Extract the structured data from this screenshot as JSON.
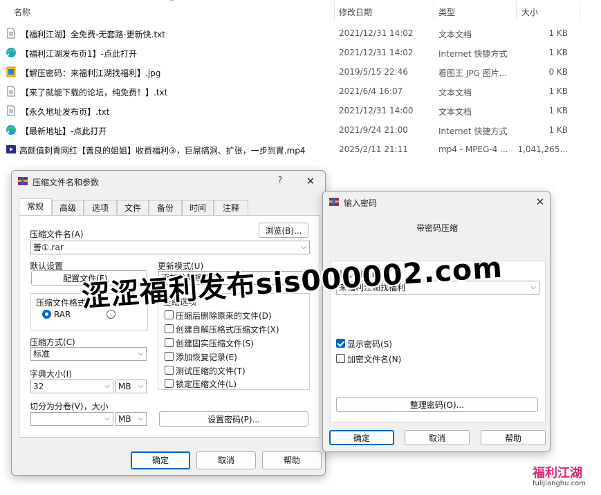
{
  "explorer": {
    "columns": {
      "name": "名称",
      "modified": "修改日期",
      "type": "类型",
      "size": "大小"
    },
    "files": [
      {
        "icon": "text-file-icon",
        "name": "【福利江湖】全免费-无套路-更新快.txt",
        "date": "2021/12/31 14:02",
        "type": "文本文档",
        "size": "1 KB"
      },
      {
        "icon": "internet-shortcut-icon",
        "name": "【福利江湖发布页1】-点此打开",
        "date": "2021/12/31 14:02",
        "type": "Internet 快捷方式",
        "size": "1 KB"
      },
      {
        "icon": "image-file-icon",
        "name": "【解压密码：来福利江湖找福利】.jpg",
        "date": "2019/5/15 22:46",
        "type": "看图王 JPG 图片...",
        "size": "0 KB"
      },
      {
        "icon": "text-file-icon",
        "name": "【来了就能下载的论坛，纯免费！】.txt",
        "date": "2021/6/4 16:07",
        "type": "文本文档",
        "size": "1 KB"
      },
      {
        "icon": "text-file-icon",
        "name": "【永久地址发布页】.txt",
        "date": "2021/12/31 14:00",
        "type": "文本文档",
        "size": "1 KB"
      },
      {
        "icon": "internet-shortcut-icon",
        "name": "【最新地址】-点此打开",
        "date": "2021/9/24 21:00",
        "type": "Internet 快捷方式",
        "size": "1 KB"
      },
      {
        "icon": "video-file-icon",
        "name": "高颜值刺青网红【善良的姐姐】收费福利③，巨屌搞洞、扩张，一步到胃.mp4",
        "date": "2025/2/11 21:11",
        "type": "mp4 - MPEG-4 ...",
        "size": "1,041,265..."
      }
    ]
  },
  "archive_dialog": {
    "title": "压缩文件名和参数",
    "help": "?",
    "tabs": [
      "常规",
      "高级",
      "选项",
      "文件",
      "备份",
      "时间",
      "注释"
    ],
    "archive_name_label": "压缩文件名(A)",
    "browse_button": "浏览(B)...",
    "archive_name_value": "善①.rar",
    "default_settings_label": "默认设置",
    "profiles_button": "配置文件(F)...",
    "update_mode_label": "更新模式(U)",
    "update_mode_value": "添加并替换文件",
    "format_label": "压缩文件格式",
    "format_rar": "RAR",
    "options_label": "压缩选项",
    "options": [
      {
        "label": "压缩后删除原来的文件(D)",
        "checked": false
      },
      {
        "label": "创建自解压格式压缩文件(X)",
        "checked": false
      },
      {
        "label": "创建固实压缩文件(S)",
        "checked": false
      },
      {
        "label": "添加恢复记录(E)",
        "checked": false
      },
      {
        "label": "测试压缩的文件(T)",
        "checked": false
      },
      {
        "label": "锁定压缩文件(L)",
        "checked": false
      }
    ],
    "method_label": "压缩方式(C)",
    "method_value": "标准",
    "dict_label": "字典大小(I)",
    "dict_value": "32",
    "dict_unit": "MB",
    "split_label": "切分为分卷(V)，大小",
    "split_value": "",
    "split_unit": "MB",
    "set_password_button": "设置密码(P)...",
    "ok": "确定",
    "cancel": "取消",
    "help_button": "帮助"
  },
  "password_dialog": {
    "title": "输入密码",
    "heading": "带密码压缩",
    "password_label": "输入密码(E)",
    "password_value": "来福利江湖找福利",
    "show_password": {
      "label": "显示密码(S)",
      "checked": true
    },
    "encrypt_names": {
      "label": "加密文件名(N)",
      "checked": false
    },
    "organize_button": "整理密码(O)...",
    "ok": "确定",
    "cancel": "取消",
    "help_button": "帮助"
  },
  "watermark": {
    "text": "涩涩福利发布sis000002.com"
  },
  "logo": {
    "name": "福利江湖",
    "url": "fulijianghu.com"
  }
}
